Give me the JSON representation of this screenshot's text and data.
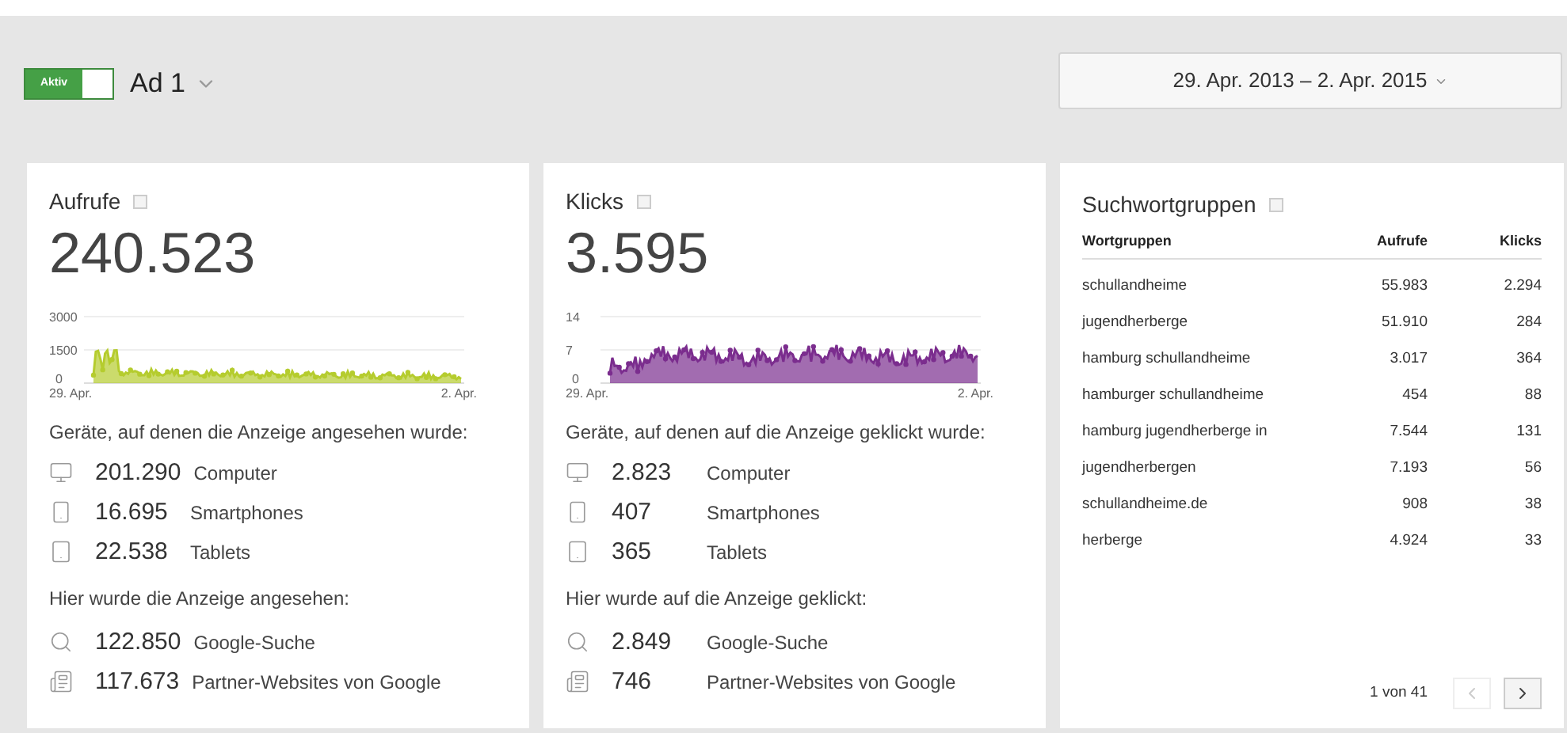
{
  "header": {
    "status_toggle": {
      "label": "Aktiv",
      "on": true
    },
    "ad_name": "Ad 1",
    "date_range": "29. Apr. 2013 – 2. Apr. 2015"
  },
  "metric_cards": [
    {
      "title": "Aufrufe",
      "total": "240.523",
      "color": "#b5cc2e",
      "y_labels": [
        "3000",
        "1500",
        "0"
      ],
      "x_labels": [
        "29. Apr.",
        "2. Apr."
      ],
      "devices_heading": "Geräte, auf denen die Anzeige angesehen wurde:",
      "devices": [
        {
          "value": "201.290",
          "label": "Computer"
        },
        {
          "value": "16.695",
          "label": "Smartphones"
        },
        {
          "value": "22.538",
          "label": "Tablets"
        }
      ],
      "networks_heading": "Hier wurde die Anzeige angesehen:",
      "networks": [
        {
          "value": "122.850",
          "label": "Google-Suche"
        },
        {
          "value": "117.673",
          "label": "Partner-Websites von Google"
        }
      ]
    },
    {
      "title": "Klicks",
      "total": "3.595",
      "color": "#7b2d8e",
      "y_labels": [
        "14",
        "7",
        "0"
      ],
      "x_labels": [
        "29. Apr.",
        "2. Apr."
      ],
      "devices_heading": "Geräte, auf denen auf die Anzeige geklickt wurde:",
      "devices": [
        {
          "value": "2.823",
          "label": "Computer"
        },
        {
          "value": "407",
          "label": "Smartphones"
        },
        {
          "value": "365",
          "label": "Tablets"
        }
      ],
      "networks_heading": "Hier wurde auf die Anzeige geklickt:",
      "networks": [
        {
          "value": "2.849",
          "label": "Google-Suche"
        },
        {
          "value": "746",
          "label": "Partner-Websites von Google"
        }
      ]
    }
  ],
  "keyword_card": {
    "title": "Suchwortgruppen",
    "columns": [
      "Wortgruppen",
      "Aufrufe",
      "Klicks"
    ],
    "rows": [
      [
        "schullandheime",
        "55.983",
        "2.294"
      ],
      [
        "jugendherberge",
        "51.910",
        "284"
      ],
      [
        "hamburg schullandheime",
        "3.017",
        "364"
      ],
      [
        "hamburger schullandheime",
        "454",
        "88"
      ],
      [
        "hamburg jugendherberge in",
        "7.544",
        "131"
      ],
      [
        "jugendherbergen",
        "7.193",
        "56"
      ],
      [
        "schullandheime.de",
        "908",
        "38"
      ],
      [
        "herberge",
        "4.924",
        "33"
      ]
    ],
    "pagination": {
      "label": "1 von 41",
      "prev_disabled": true,
      "next_disabled": false
    }
  }
}
